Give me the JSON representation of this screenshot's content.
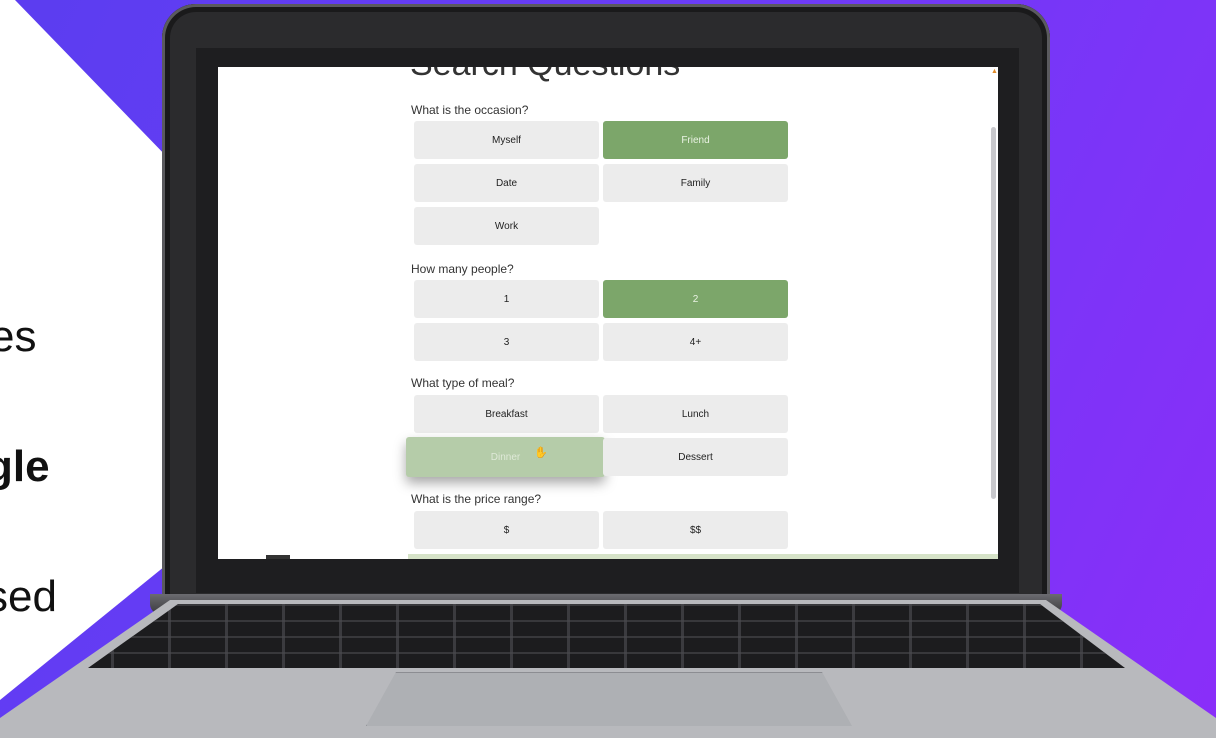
{
  "side_text": [
    "es",
    "gle",
    "sed"
  ],
  "screen": {
    "heading": "Search Questions",
    "questions": [
      {
        "label": "What is the occasion?",
        "options": [
          {
            "label": "Myself",
            "selected": false
          },
          {
            "label": "Friend",
            "selected": true
          },
          {
            "label": "Date",
            "selected": false
          },
          {
            "label": "Family",
            "selected": false
          },
          {
            "label": "Work",
            "selected": false
          }
        ]
      },
      {
        "label": "How many people?",
        "options": [
          {
            "label": "1",
            "selected": false
          },
          {
            "label": "2",
            "selected": true
          },
          {
            "label": "3",
            "selected": false
          },
          {
            "label": "4+",
            "selected": false
          }
        ]
      },
      {
        "label": "What type of meal?",
        "options": [
          {
            "label": "Breakfast",
            "selected": false
          },
          {
            "label": "Lunch",
            "selected": false
          },
          {
            "label": "Dinner",
            "selected": false,
            "state": "pressed"
          },
          {
            "label": "Dessert",
            "selected": false
          }
        ]
      },
      {
        "label": "What is the price range?",
        "options": [
          {
            "label": "$",
            "selected": false
          },
          {
            "label": "$$",
            "selected": false
          }
        ]
      }
    ]
  },
  "colors": {
    "selected": "#7ca66a",
    "unselected": "#ececec",
    "background_gradient_start": "#5b3df0",
    "background_gradient_end": "#8a2ef9"
  }
}
